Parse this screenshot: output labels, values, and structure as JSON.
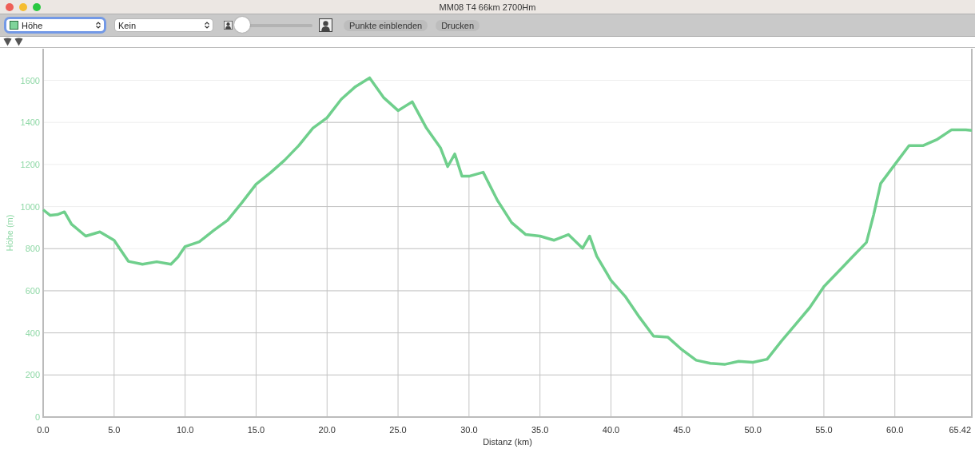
{
  "window": {
    "title": "MM08 T4 66km 2700Hm"
  },
  "toolbar": {
    "dropdowns": [
      {
        "value": "Höhe",
        "swatch": true,
        "focused": true
      },
      {
        "value": "Kein",
        "swatch": false,
        "focused": false
      }
    ],
    "slider": {
      "level": 0
    },
    "buttons": [
      "Punkte einblenden",
      "Drucken"
    ]
  },
  "chart": {
    "chart_data": {
      "type": "line",
      "xlabel": "Distanz (km)",
      "ylabel": "Höhe (m)",
      "x": [
        0,
        0.5,
        1,
        1.5,
        2,
        3,
        4,
        5,
        6,
        7,
        8,
        9,
        9.5,
        10,
        11,
        12,
        13,
        14,
        15,
        16,
        17,
        18,
        19,
        20,
        21,
        22,
        23,
        24,
        25,
        26,
        27,
        28,
        28.5,
        29,
        29.5,
        30,
        31,
        32,
        33,
        34,
        35,
        36,
        37,
        38,
        38.5,
        39,
        40,
        41,
        42,
        43,
        44,
        45,
        46,
        47,
        48,
        49,
        50,
        51,
        52,
        53,
        54,
        55,
        56,
        57,
        58,
        58.5,
        59,
        60,
        61,
        62,
        63,
        64,
        65,
        65.42
      ],
      "series": [
        {
          "color": "#6fcf8c",
          "values": [
            985,
            958,
            962,
            975,
            916,
            860,
            880,
            840,
            740,
            726,
            738,
            726,
            760,
            810,
            833,
            886,
            935,
            1019,
            1106,
            1160,
            1220,
            1289,
            1373,
            1422,
            1510,
            1570,
            1612,
            1517,
            1456,
            1498,
            1373,
            1278,
            1190,
            1250,
            1145,
            1144,
            1163,
            1030,
            924,
            867,
            860,
            840,
            867,
            802,
            860,
            764,
            650,
            574,
            475,
            384,
            380,
            320,
            270,
            255,
            250,
            265,
            260,
            275,
            360,
            440,
            520,
            620,
            690,
            760,
            830,
            960,
            1110,
            1200,
            1290,
            1290,
            1320,
            1365,
            1365,
            1362
          ]
        }
      ],
      "grid": true,
      "xlim": [
        0,
        65.42
      ],
      "ylim": [
        0,
        1750
      ],
      "xticks": [
        {
          "value": 0,
          "label": "0.0"
        },
        {
          "value": 5,
          "label": "5.0"
        },
        {
          "value": 10,
          "label": "10.0"
        },
        {
          "value": 15,
          "label": "15.0"
        },
        {
          "value": 20,
          "label": "20.0"
        },
        {
          "value": 25,
          "label": "25.0"
        },
        {
          "value": 30,
          "label": "30.0"
        },
        {
          "value": 35,
          "label": "35.0"
        },
        {
          "value": 40,
          "label": "40.0"
        },
        {
          "value": 45,
          "label": "45.0"
        },
        {
          "value": 50,
          "label": "50.0"
        },
        {
          "value": 55,
          "label": "55.0"
        },
        {
          "value": 60,
          "label": "60.0"
        },
        {
          "value": 65.42,
          "label": "65.42"
        }
      ],
      "yticks": [
        0,
        200,
        400,
        600,
        800,
        1000,
        1200,
        1400,
        1600
      ]
    }
  }
}
